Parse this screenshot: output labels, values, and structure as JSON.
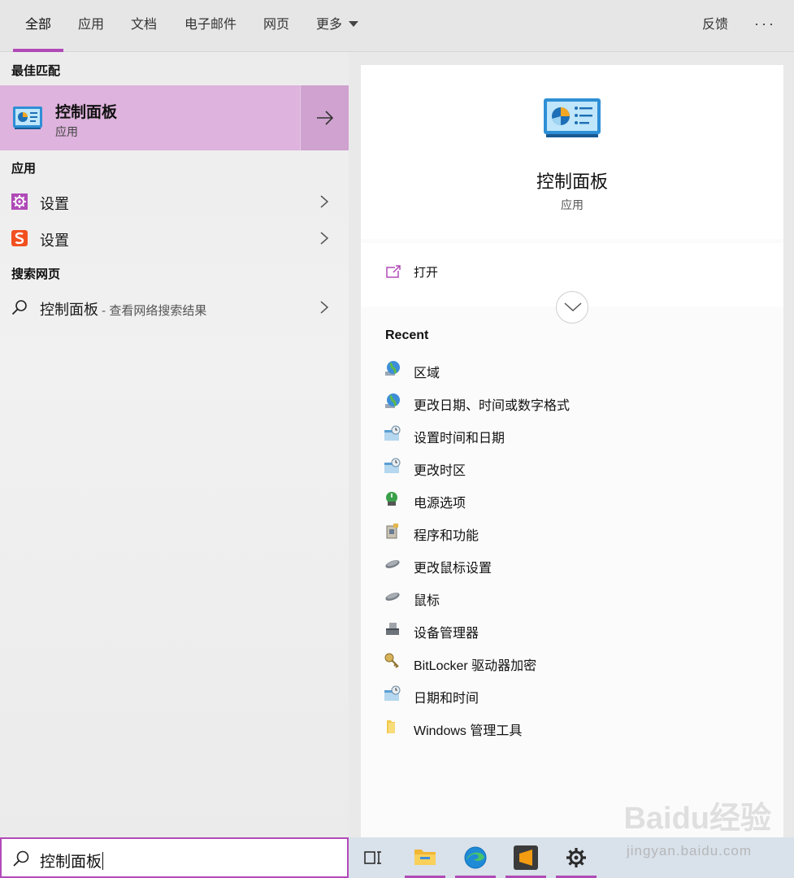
{
  "tabs": [
    {
      "label": "全部",
      "active": true
    },
    {
      "label": "应用"
    },
    {
      "label": "文档"
    },
    {
      "label": "电子邮件"
    },
    {
      "label": "网页"
    },
    {
      "label": "更多"
    }
  ],
  "top_right": {
    "feedback_label": "反馈",
    "more_options_label": "···"
  },
  "left": {
    "best_match_heading": "最佳匹配",
    "best_match": {
      "title": "控制面板",
      "subtitle": "应用"
    },
    "apps_heading": "应用",
    "apps": [
      {
        "label": "设置",
        "icon": "gear-icon"
      },
      {
        "label": "设置",
        "icon": "sogou-s-icon"
      }
    ],
    "web_heading": "搜索网页",
    "web_result": {
      "label": "控制面板",
      "hint": " - 查看网络搜索结果"
    }
  },
  "right": {
    "title": "控制面板",
    "subtitle": "应用",
    "open_label": "打开",
    "recent_heading": "Recent",
    "recent_items": [
      {
        "label": "区域",
        "icon": "globe-icon"
      },
      {
        "label": "更改日期、时间或数字格式",
        "icon": "globe-icon"
      },
      {
        "label": "设置时间和日期",
        "icon": "datetime-icon"
      },
      {
        "label": "更改时区",
        "icon": "datetime-icon"
      },
      {
        "label": "电源选项",
        "icon": "power-options-icon"
      },
      {
        "label": "程序和功能",
        "icon": "programs-icon"
      },
      {
        "label": "更改鼠标设置",
        "icon": "mouse-icon"
      },
      {
        "label": "鼠标",
        "icon": "mouse-icon"
      },
      {
        "label": "设备管理器",
        "icon": "device-manager-icon"
      },
      {
        "label": "BitLocker 驱动器加密",
        "icon": "bitlocker-key-icon"
      },
      {
        "label": "日期和时间",
        "icon": "datetime-icon"
      },
      {
        "label": "Windows 管理工具",
        "icon": "folder-icon"
      }
    ]
  },
  "search": {
    "value": "控制面板"
  },
  "watermark": {
    "logo": "Baidu经验",
    "url": "jingyan.baidu.com"
  },
  "colors": {
    "accent": "#b04ab7",
    "best_match_bg": "#deb3dd",
    "taskbar": "#d9e1ea"
  }
}
